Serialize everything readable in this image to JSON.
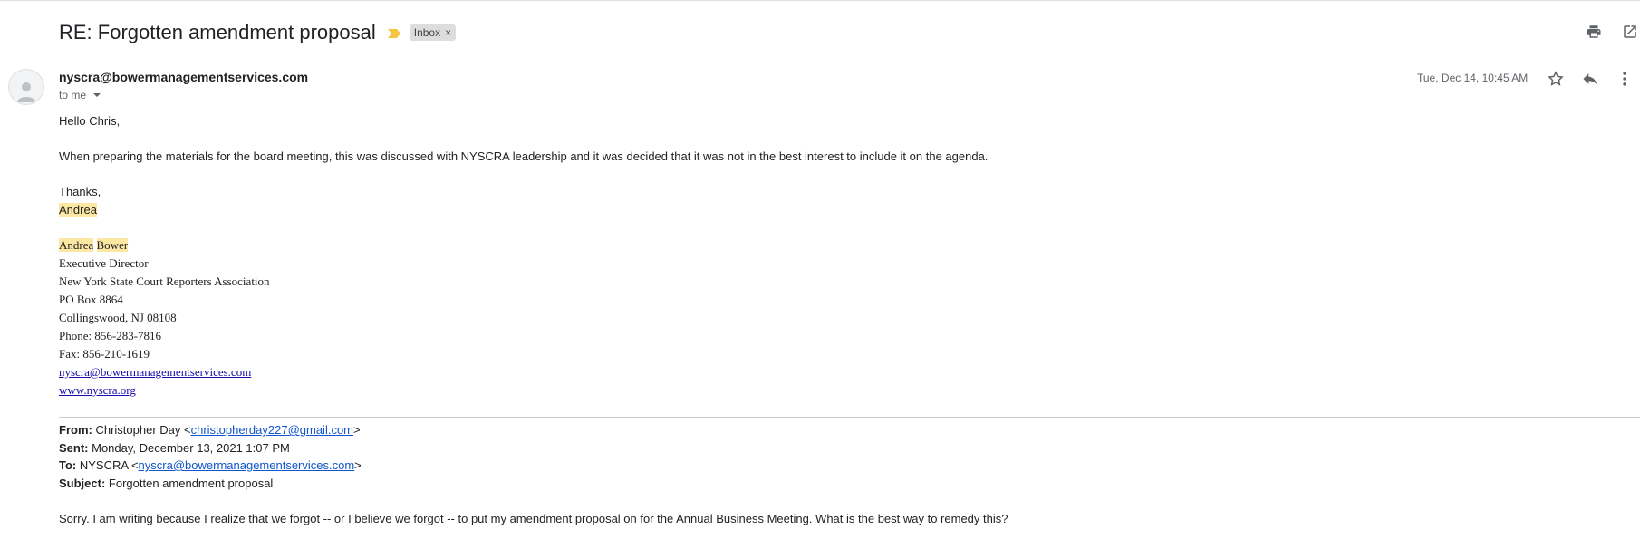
{
  "email": {
    "subject": "RE: Forgotten amendment proposal",
    "label": "Inbox",
    "label_remove": "×",
    "sender_email": "nyscra@bowermanagementservices.com",
    "recipient_text": "to me",
    "date": "Tue, Dec 14, 10:45 AM",
    "body": {
      "greeting": "Hello Chris,",
      "paragraph": "When preparing the materials for the board meeting, this was discussed with NYSCRA leadership and it was decided that it was not in the best interest to include it on the agenda.",
      "closing": "Thanks,",
      "name": "Andrea"
    },
    "signature": {
      "first_name": "Andrea",
      "last_name": "Bower",
      "title": "Executive Director",
      "org": "New York State Court Reporters Association",
      "po_box": "PO Box 8864",
      "city": "Collingswood, NJ 08108",
      "phone": "Phone: 856-283-7816",
      "fax": "Fax: 856-210-1619",
      "email": "nyscra@bowermanagementservices.com",
      "website": "www.nyscra.org"
    },
    "quoted": {
      "from_label": "From:",
      "from_name": "Christopher Day <",
      "from_email": "christopherday227@gmail.com",
      "from_close": ">",
      "sent_label": "Sent:",
      "sent_value": "Monday, December 13, 2021 1:07 PM",
      "to_label": "To:",
      "to_name": "NYSCRA <",
      "to_email": "nyscra@bowermanagementservices.com",
      "to_close": ">",
      "subject_label": "Subject:",
      "subject_value": "Forgotten amendment proposal",
      "body": "Sorry. I am writing because I realize that we forgot -- or I believe we forgot -- to put my amendment proposal on for the Annual Business Meeting. What is the best way to remedy this?"
    }
  },
  "icons": {
    "print": "print-icon",
    "open_new_window": "open-in-new-window-icon",
    "star": "star-icon",
    "reply": "reply-icon",
    "more": "more-vert-icon",
    "importance": "importance-marker-icon",
    "avatar": "person-icon"
  },
  "colors": {
    "highlight": "#fce8a3",
    "importance": "#f4c542",
    "link": "#1a0dab"
  }
}
